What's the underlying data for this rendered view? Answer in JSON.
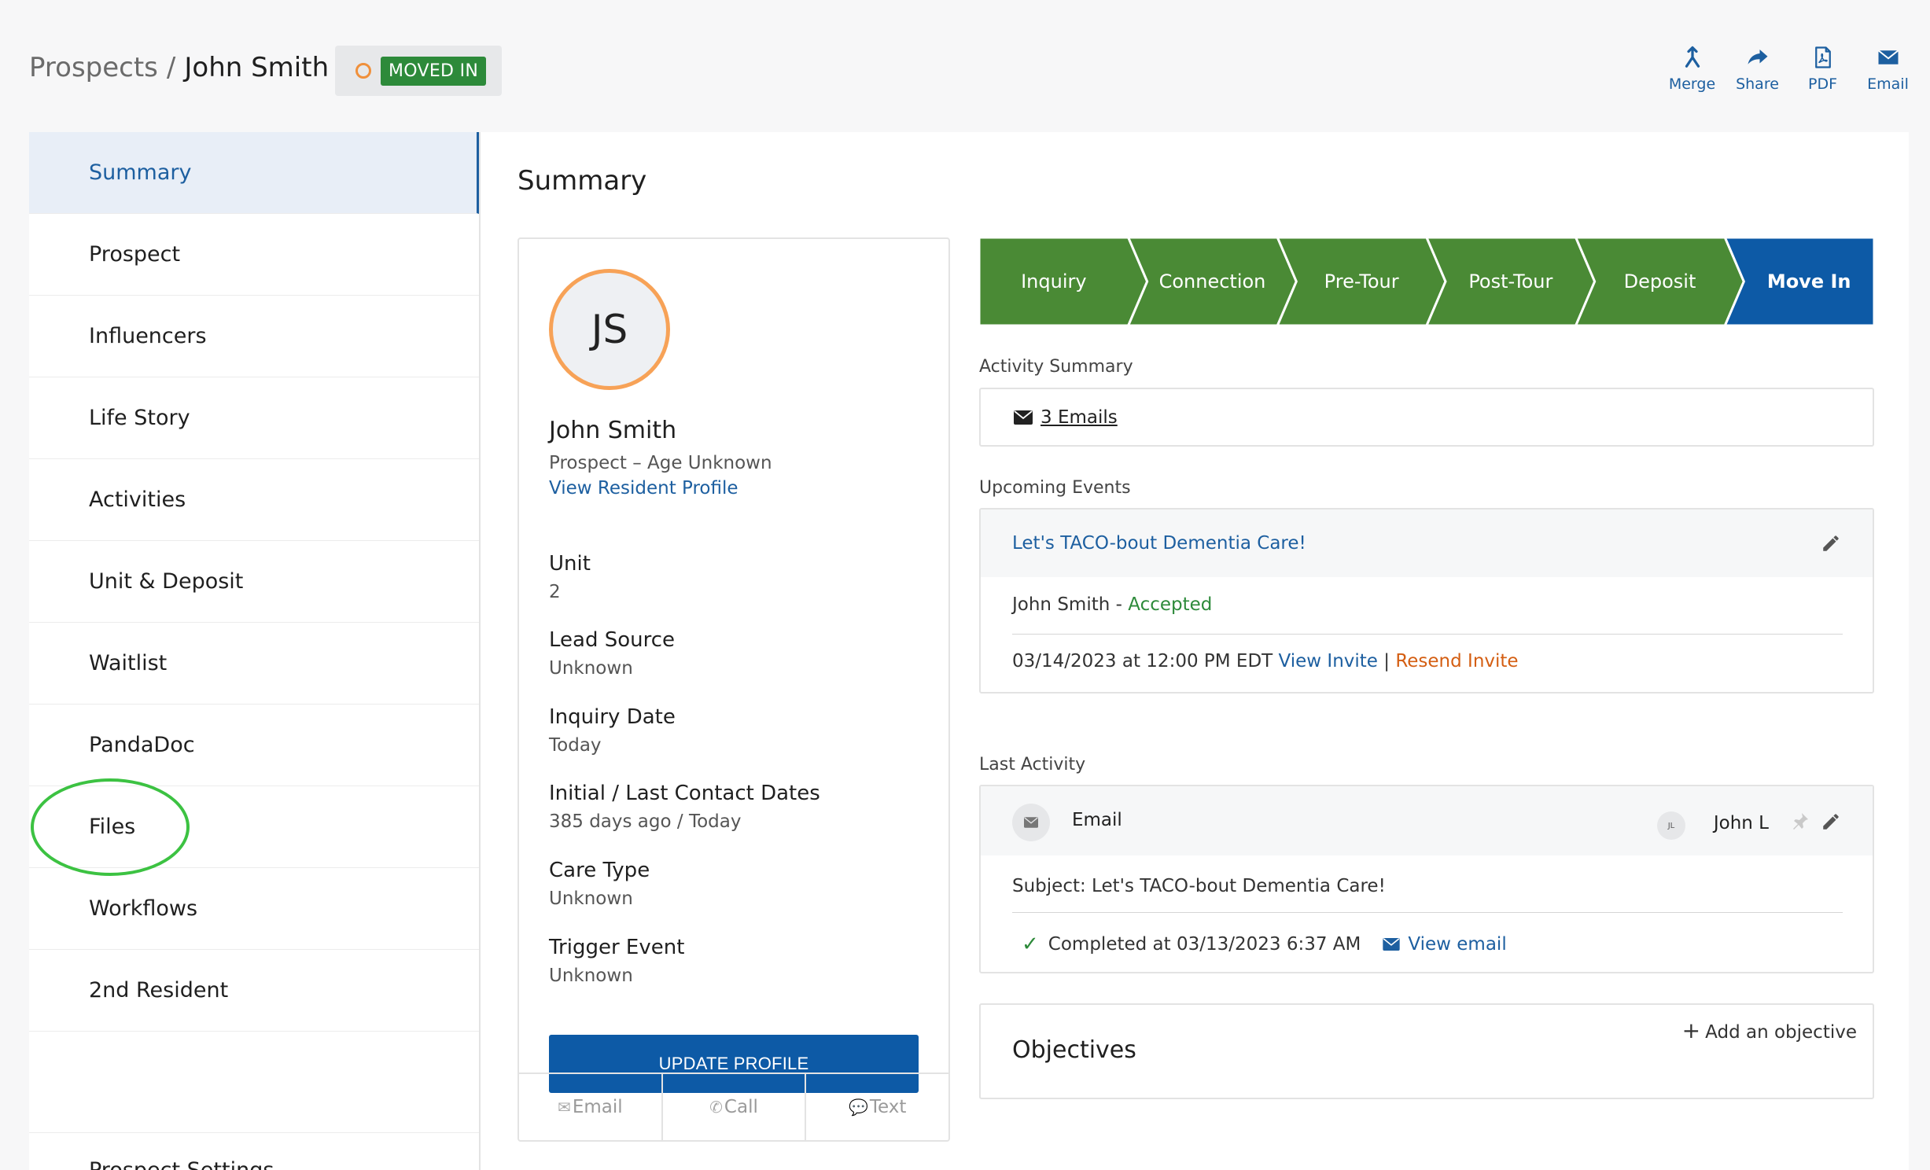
{
  "header": {
    "breadcrumb_parent": "Prospects",
    "breadcrumb_separator": "/",
    "breadcrumb_current": "John Smith",
    "status_badge": "MOVED IN",
    "actions": [
      {
        "label": "Merge",
        "icon": "merge-icon"
      },
      {
        "label": "Share",
        "icon": "share-icon"
      },
      {
        "label": "PDF",
        "icon": "pdf-icon"
      },
      {
        "label": "Email",
        "icon": "envelope-icon"
      }
    ]
  },
  "sidebar": {
    "items": [
      {
        "label": "Summary",
        "active": true
      },
      {
        "label": "Prospect"
      },
      {
        "label": "Influencers"
      },
      {
        "label": "Life Story"
      },
      {
        "label": "Activities"
      },
      {
        "label": "Unit & Deposit"
      },
      {
        "label": "Waitlist"
      },
      {
        "label": "PandaDoc"
      },
      {
        "label": "Files",
        "annotated": true
      },
      {
        "label": "Workflows"
      },
      {
        "label": "2nd Resident"
      }
    ],
    "settings_label": "Prospect Settings"
  },
  "main": {
    "title": "Summary"
  },
  "profile": {
    "initials": "JS",
    "name": "John Smith",
    "subtitle": "Prospect – Age Unknown",
    "view_link": "View Resident Profile",
    "fields": [
      {
        "label": "Unit",
        "value": "2"
      },
      {
        "label": "Lead Source",
        "value": "Unknown"
      },
      {
        "label": "Inquiry Date",
        "value": "Today"
      },
      {
        "label": "Initial / Last Contact Dates",
        "value": "385 days ago / Today"
      },
      {
        "label": "Care Type",
        "value": "Unknown"
      },
      {
        "label": "Trigger Event",
        "value": "Unknown"
      }
    ],
    "update_button": "UPDATE PROFILE",
    "footer": {
      "email": "Email",
      "call": "Call",
      "text": "Text"
    }
  },
  "pipeline": {
    "stages": [
      "Inquiry",
      "Connection",
      "Pre-Tour",
      "Post-Tour",
      "Deposit",
      "Move In"
    ],
    "current_index": 5,
    "colors": {
      "done": "#4a8a35",
      "current": "#0d5aa6"
    }
  },
  "activity_summary": {
    "label": "Activity Summary",
    "emails_link": "3 Emails"
  },
  "upcoming_events": {
    "label": "Upcoming Events",
    "event_title": "Let's TACO-bout Dementia Care!",
    "attendee_name": "John Smith",
    "attendee_sep": " - ",
    "attendee_status": "Accepted",
    "datetime": "03/14/2023 at 12:00 PM EDT",
    "view_invite": "View Invite",
    "pipe": " | ",
    "resend_invite": "Resend Invite"
  },
  "last_activity": {
    "label": "Last Activity",
    "type": "Email",
    "user_initials": "JL",
    "user_name": "John L",
    "subject": "Subject: Let's TACO-bout Dementia Care!",
    "completed": "Completed at 03/13/2023 6:37 AM",
    "view_email": "View email"
  },
  "objectives": {
    "title": "Objectives",
    "add_label": "Add an objective"
  }
}
